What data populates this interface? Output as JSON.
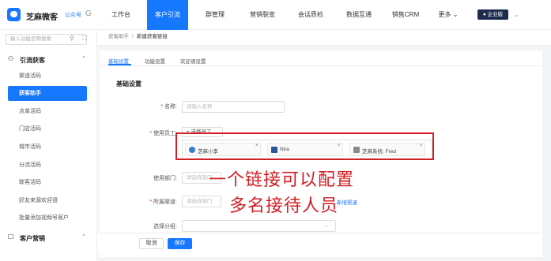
{
  "topbar": {
    "brand_name": "芝麻微客",
    "brand_sub": "公众号",
    "brand_tag": "G",
    "nav": [
      {
        "label": "工作台"
      },
      {
        "label": "客户引流"
      },
      {
        "label": "群管理"
      },
      {
        "label": "营销裂变"
      },
      {
        "label": "会话质检"
      },
      {
        "label": "数据互通"
      },
      {
        "label": "销售CRM"
      },
      {
        "label": "更多 ⌄"
      }
    ],
    "enterprise_label": "● 企业版",
    "chevron": "⌄"
  },
  "sidebar": {
    "search_placeholder": "输入功能名称搜索",
    "search_icon": "⚲",
    "tool_icon": "⛶",
    "group1": {
      "icon": "⚇",
      "label": "引流获客",
      "chevron": "⌃"
    },
    "items": [
      {
        "label": "渠道活码"
      },
      {
        "label": "获客助手"
      },
      {
        "label": "点单活码"
      },
      {
        "label": "门店活码"
      },
      {
        "label": "城市活码"
      },
      {
        "label": "分流活码"
      },
      {
        "label": "联客活码"
      },
      {
        "label": "好友来源欢迎语"
      },
      {
        "label": "批量添加视频号客户"
      }
    ],
    "group2": {
      "icon": "☐",
      "label": "客户营销",
      "chevron": "⌃"
    }
  },
  "breadcrumb": {
    "parent": "获客助手",
    "sep": "/",
    "current": "新建获客链接"
  },
  "tabs": [
    {
      "label": "基础设置"
    },
    {
      "label": "功能设置"
    },
    {
      "label": "欢迎语设置"
    }
  ],
  "form": {
    "section_title": "基础设置",
    "name_label": "名称:",
    "name_placeholder": "请输入名称",
    "staff_label": "使用员工:",
    "add_staff": "+ 选择员工",
    "staff": [
      {
        "name": "芝麻小李"
      },
      {
        "name": "Nira"
      },
      {
        "name": "芝麻系统: Fred"
      }
    ],
    "remove_icon": "×",
    "dept_label": "使用部门:",
    "dept_placeholder": "请选择部门",
    "channel_label": "所属渠道:",
    "channel_placeholder": "请选择部门",
    "channel_link": "新增渠道",
    "group_label": "选择分组:",
    "required_mark": "*"
  },
  "annotation": {
    "line1": "一个链接可以配置",
    "line2": "多名接待人员"
  },
  "footer": {
    "cancel": "取消",
    "save": "保存"
  },
  "colors": {
    "accent": "#1677ff",
    "annotation": "#d11f25"
  }
}
